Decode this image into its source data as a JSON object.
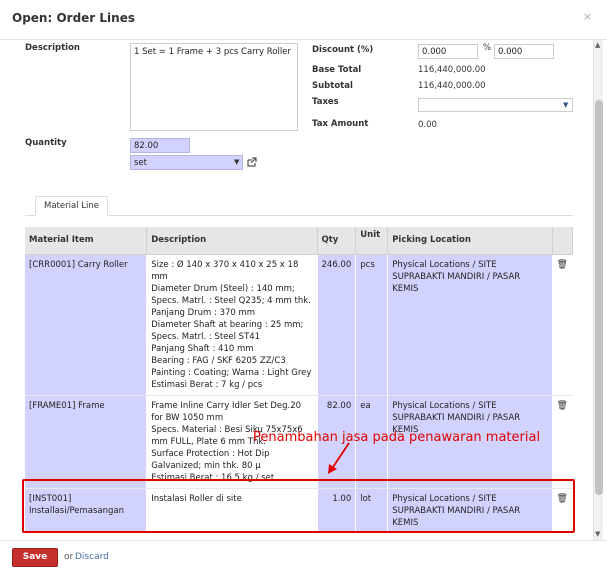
{
  "dialog": {
    "title": "Open: Order Lines",
    "close_label": "×"
  },
  "form": {
    "description_label": "Description",
    "description_value": "1 Set = 1 Frame + 3 pcs Carry Roller",
    "quantity_label": "Quantity",
    "quantity_value": "82.00",
    "uom_value": "set",
    "discount_label": "Discount (%)",
    "discount_value": "0.000",
    "discount_pct_symbol": "%",
    "discount_value2": "0.000",
    "base_total_label": "Base Total",
    "base_total_value": "116,440,000.00",
    "subtotal_label": "Subtotal",
    "subtotal_value": "116,440,000.00",
    "taxes_label": "Taxes",
    "taxes_value": "",
    "tax_amount_label": "Tax Amount",
    "tax_amount_value": "0.00"
  },
  "tab": {
    "label": "Material Line"
  },
  "table": {
    "headers": [
      "Material Item",
      "Description",
      "Qty",
      "Unit",
      "Picking Location"
    ],
    "rows": [
      {
        "item": "[CRR0001] Carry Roller",
        "description": "Size : Ø 140 x 370 x 410 x 25 x 18 mm\nDiameter Drum (Steel) : 140 mm;\nSpecs. Matrl. : Steel Q235; 4 mm thk.\nPanjang Drum : 370 mm\nDiameter Shaft at bearing : 25 mm;\nSpecs. Matrl. : Steel ST41\nPanjang Shaft : 410 mm\nBearing : FAG / SKF 6205 ZZ/C3\nPainting : Coating; Warna : Light Grey\nEstimasi Berat : 7 kg / pcs",
        "qty": "246.00",
        "unit": "pcs",
        "location": "Physical Locations / SITE SUPRABAKTI MANDIRI / PASAR KEMIS"
      },
      {
        "item": "[FRAME01] Frame",
        "description": "Frame Inline Carry Idler Set Deg.20 for BW 1050 mm\nSpecs. Material : Besi Siku 75x75x6 mm FULL, Plate 6 mm Thk.\nSurface Protection : Hot Dip Galvanized; min thk. 80 µ\nEstimasi Berat : 16.5 kg / set",
        "qty": "82.00",
        "unit": "ea",
        "location": "Physical Locations / SITE SUPRABAKTI MANDIRI / PASAR KEMIS"
      },
      {
        "item": "[INST001] Installasi/Pemasangan",
        "description": "Instalasi Roller di site",
        "qty": "1.00",
        "unit": "lot",
        "location": "Physical Locations / SITE SUPRABAKTI MANDIRI / PASAR KEMIS"
      }
    ]
  },
  "annotation": {
    "text": "Penambahan jasa pada penawaran material",
    "color": "#e00000"
  },
  "footer": {
    "save_label": "Save",
    "or_label": "or",
    "discard_label": "Discard"
  },
  "icons": {
    "trash": "trash-icon",
    "close": "close-icon",
    "external": "external-link-icon"
  }
}
